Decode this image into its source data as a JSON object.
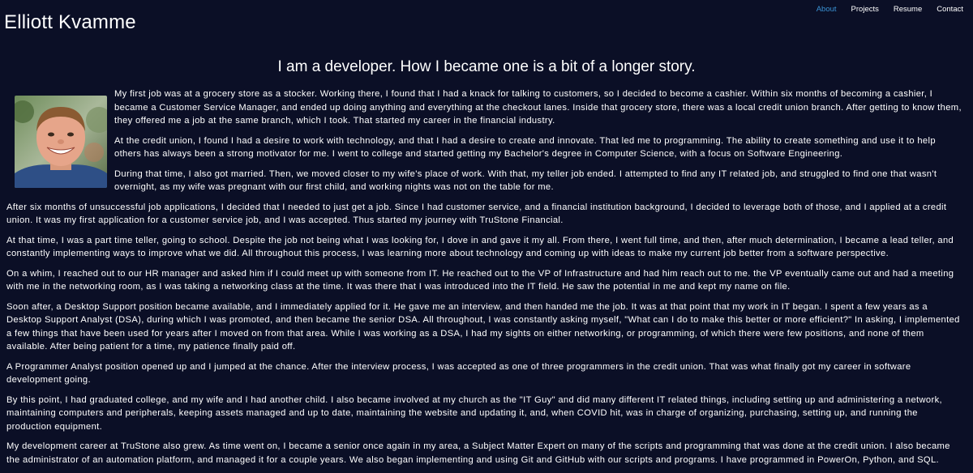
{
  "header": {
    "brand": "Elliott Kvamme",
    "nav": [
      {
        "label": "About",
        "active": true
      },
      {
        "label": "Projects"
      },
      {
        "label": "Resume"
      },
      {
        "label": "Contact"
      }
    ]
  },
  "main": {
    "headline": "I am a developer. How I became one is a bit of a longer story.",
    "avatar_icon": "profile-photo",
    "paragraphs": [
      "My first job was at a grocery store as a stocker. Working there, I found that I had a knack for talking to customers, so I decided to become a cashier. Within six months of becoming a cashier, I became a Customer Service Manager, and ended up doing anything and everything at the checkout lanes. Inside that grocery store, there was a local credit union branch. After getting to know them, they offered me a job at the same branch, which I took. That started my career in the financial industry.",
      "At the credit union, I found I had a desire to work with technology, and that I had a desire to create and innovate. That led me to programming. The ability to create something and use it to help others has always been a strong motivator for me. I went to college and started getting my Bachelor's degree in Computer Science, with a focus on Software Engineering.",
      "During that time, I also got married. Then, we moved closer to my wife's place of work. With that, my teller job ended. I attempted to find any IT related job, and struggled to find one that wasn't overnight, as my wife was pregnant with our first child, and working nights was not on the table for me.",
      "After six months of unsuccessful job applications, I decided that I needed to just get a job. Since I had customer service, and a financial institution background, I decided to leverage both of those, and I applied at a credit union. It was my first application for a customer service job, and I was accepted. Thus started my journey with TruStone Financial.",
      "At that time, I was a part time teller, going to school. Despite the job not being what I was looking for, I dove in and gave it my all. From there, I went full time, and then, after much determination, I became a lead teller, and constantly implementing ways to improve what we did. All throughout this process, I was learning more about technology and coming up with ideas to make my current job better from a software perspective.",
      "On a whim, I reached out to our HR manager and asked him if I could meet up with someone from IT. He reached out to the VP of Infrastructure and had him reach out to me. the VP eventually came out and had a meeting with me in the networking room, as I was taking a networking class at the time. It was there that I was introduced into the IT field. He saw the potential in me and kept my name on file.",
      "Soon after, a Desktop Support position became available, and I immediately applied for it. He gave me an interview, and then handed me the job. It was at that point that my work in IT began. I spent a few years as a Desktop Support Analyst (DSA), during which I was promoted, and then became the senior DSA. All throughout, I was constantly asking myself, \"What can I do to make this better or more efficient?\" In asking, I implemented a few things that have been used for years after I moved on from that area. While I was working as a DSA, I had my sights on either networking, or programming, of which there were few positions, and none of them available. After being patient for a time, my patience finally paid off.",
      "A Programmer Analyst position opened up and I jumped at the chance. After the interview process, I was accepted as one of three programmers in the credit union. That was what finally got my career in software development going.",
      "By this point, I had graduated college, and my wife and I had another child. I also became involved at my church as the \"IT Guy\" and did many different IT related things, including setting up and administering a network, maintaining computers and peripherals, keeping assets managed and up to date, maintaining the website and updating it, and, when COVID hit, was in charge of organizing, purchasing, setting up, and running the production equipment.",
      "My development career at TruStone also grew. As time went on, I became a senior once again in my area, a Subject Matter Expert on many of the scripts and programming that was done at the credit union. I also became the administrator of an automation platform, and managed it for a couple years. We also began implementing and using Git and GitHub with our scripts and programs. I have programmed in PowerOn, Python, and SQL."
    ]
  }
}
